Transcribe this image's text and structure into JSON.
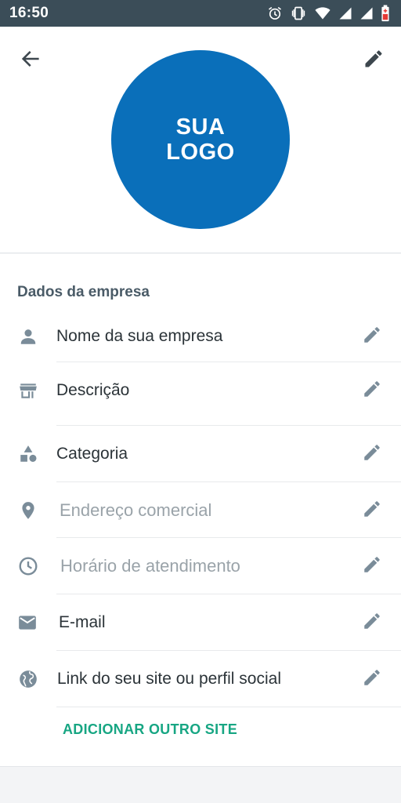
{
  "status_bar": {
    "time": "16:50",
    "icons": [
      "alarm-icon",
      "vibrate-icon",
      "wifi-icon",
      "signal-icon",
      "signal-icon",
      "battery-icon"
    ]
  },
  "header": {
    "back_icon": "arrow-back-icon",
    "edit_icon": "pencil-icon",
    "logo_text": "SUA\nLOGO",
    "logo_color": "#0a6fba"
  },
  "section": {
    "title": "Dados da empresa",
    "items": [
      {
        "icon": "person-icon",
        "label": "Nome da sua empresa"
      },
      {
        "icon": "store-icon",
        "label": "Descrição"
      },
      {
        "icon": "category-icon",
        "label": "Categoria"
      },
      {
        "icon": "location-pin-icon",
        "label": "Endereço comercial"
      },
      {
        "icon": "clock-icon",
        "label": "Horário de atendimento"
      },
      {
        "icon": "email-icon",
        "label": "E-mail"
      },
      {
        "icon": "globe-icon",
        "label": "Link do seu site ou perfil social"
      }
    ],
    "add_site_label": "ADICIONAR OUTRO SITE"
  },
  "colors": {
    "status_bar": "#3b4d58",
    "accent_green": "#17a683",
    "icon_gray": "#7a8c99"
  }
}
